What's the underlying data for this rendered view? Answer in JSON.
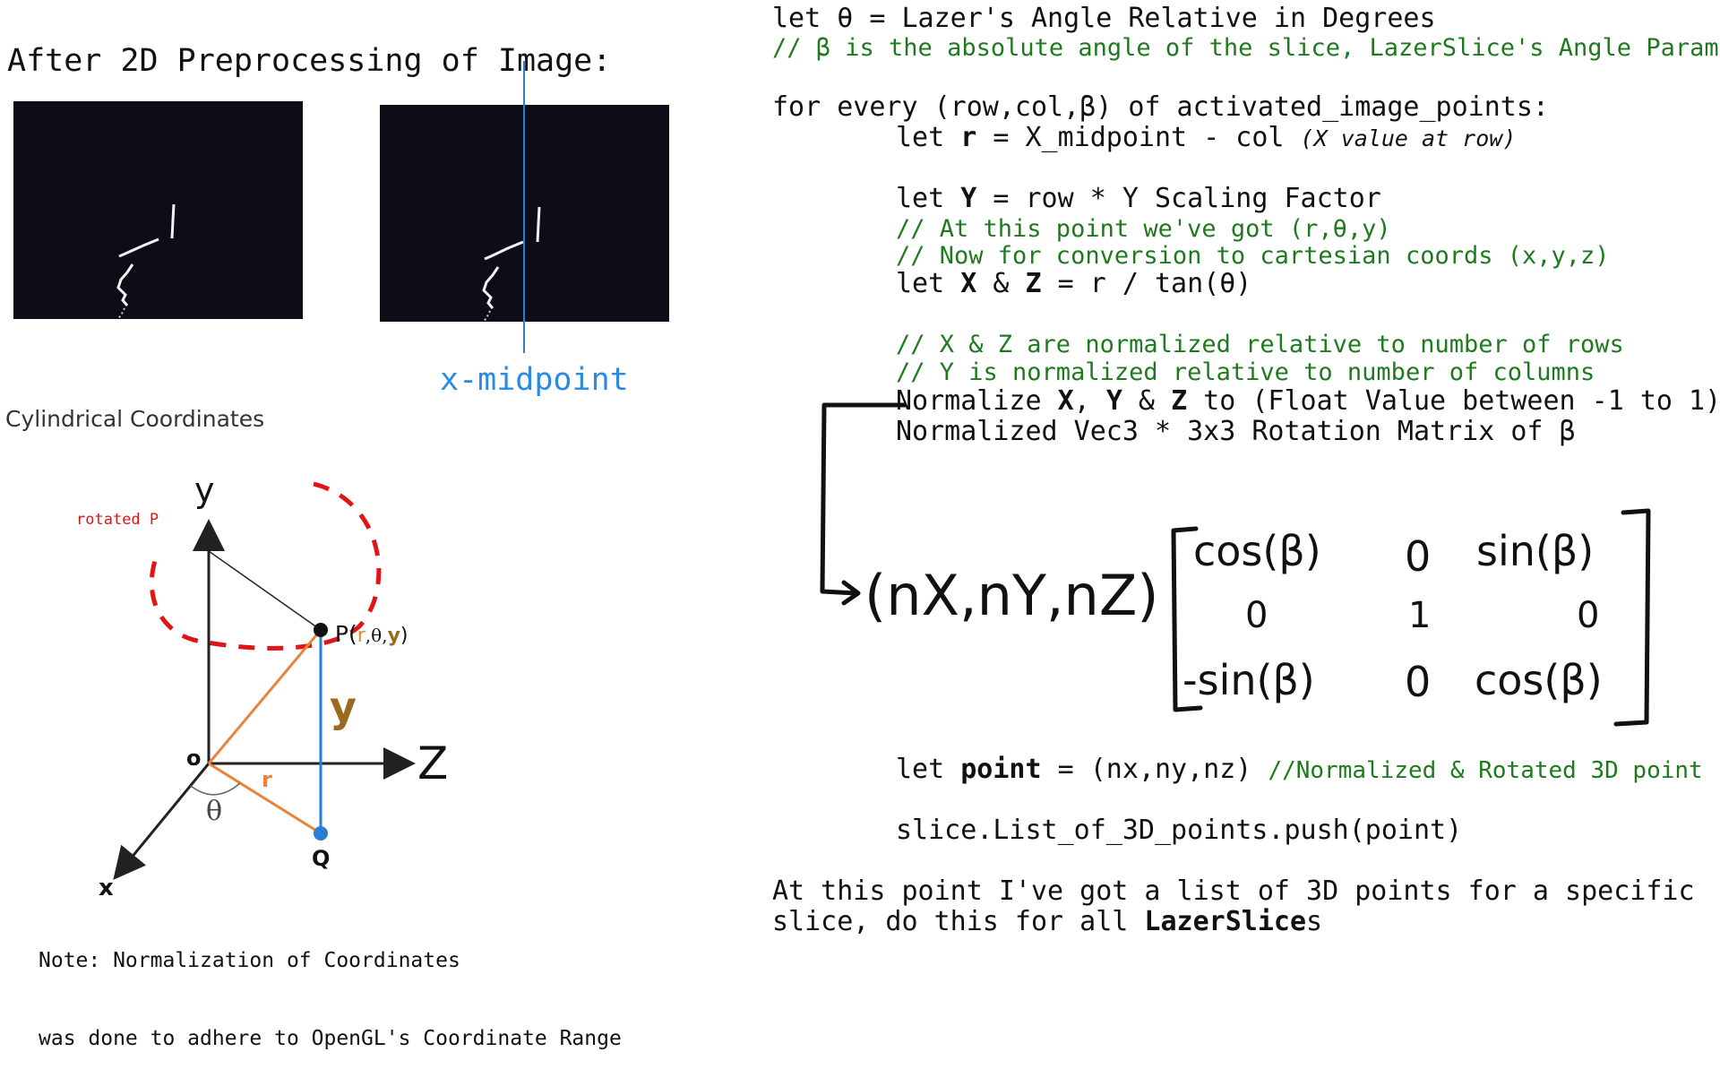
{
  "left": {
    "heading": "After 2D Preprocessing of Image:",
    "midpoint_label": "x-midpoint",
    "cyl_title": "Cylindrical Coordinates",
    "diagram": {
      "axis_y": "y",
      "axis_z": "Z",
      "axis_x": "x",
      "origin": "o",
      "rotated_p": "rotated P",
      "p_label": "P(",
      "p_r": "r",
      "p_mid": ",θ,",
      "p_y": "y",
      "p_close": ")",
      "y_height": "y",
      "r_label": "r",
      "theta": "θ",
      "q_label": "Q",
      "colors": {
        "orange": "#e8833a",
        "blue": "#2a7fd4",
        "brown": "#9a6a1f",
        "red": "#e01515"
      }
    },
    "note_line1": "Note: Normalization of Coordinates",
    "note_line2": "was done to adhere to OpenGL's Coordinate Range"
  },
  "code": {
    "l1_pre": "let θ = Lazer's Angle Relative in Degrees",
    "l2": "// β is the absolute angle of the slice, LazerSlice's Angle Param",
    "l3": "for every (row,col,β) of activated_image_points:",
    "l4_a": "let ",
    "l4_b": "r",
    "l4_c": " = X_midpoint - col ",
    "l4_d": "(X value at row)",
    "l5_a": "let ",
    "l5_b": "Y",
    "l5_c": " = row * Y Scaling Factor",
    "l6": "// At this point we've got (r,θ,y)",
    "l7": "// Now for conversion to cartesian coords (x,y,z)",
    "l8_a": "let ",
    "l8_b": "X",
    "l8_c": " & ",
    "l8_d": "Z",
    "l8_e": " = r / tan(θ)",
    "l9": "// X & Z are normalized relative to number of rows",
    "l10": "// Y is normalized relative to number of columns",
    "l11_a": "Normalize ",
    "l11_b": "X",
    "l11_c": ", ",
    "l11_d": "Y",
    "l11_e": " & ",
    "l11_f": "Z",
    "l11_g": " to (Float Value between -1 to 1)",
    "l12": "Normalized Vec3 * 3x3 Rotation Matrix of β",
    "l13_a": "let ",
    "l13_b": "point",
    "l13_c": " = (nx,ny,nz) ",
    "l13_d": "//Normalized & Rotated 3D point",
    "l14": "slice.List_of_3D_points.push(point)",
    "l15": "At this point I've got a list of 3D points for a specific",
    "l16_a": "slice, do this for all ",
    "l16_b": "LazerSlice",
    "l16_c": "s"
  },
  "matrix": {
    "vector": "(nX,nY,nZ)",
    "row1": [
      "cos(β)",
      "0",
      "sin(β)"
    ],
    "row2": [
      "0",
      "1",
      "0"
    ],
    "row3": [
      "-sin(β)",
      "0",
      "cos(β)"
    ]
  }
}
